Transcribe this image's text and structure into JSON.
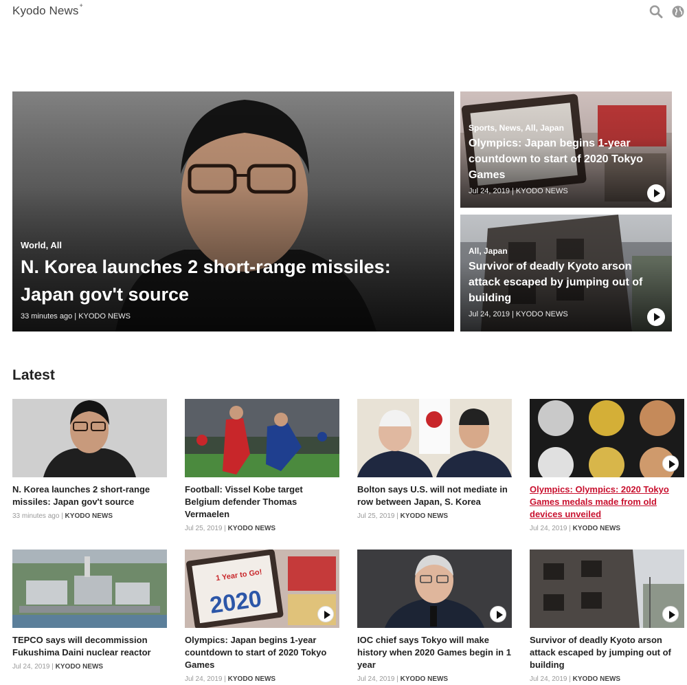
{
  "header": {
    "logo": "Kyodo News",
    "logo_mark": "+",
    "search_icon": "search-icon",
    "language_icon": "globe-icon"
  },
  "featured": {
    "main": {
      "categories": "World, All",
      "title": "N. Korea launches 2 short-range missiles: Japan gov't source",
      "time": "33 minutes ago",
      "source": "KYODO NEWS"
    },
    "side_top": {
      "categories": "Sports, News, All, Japan",
      "title": "Olympics: Japan begins 1-year countdown to start of 2020 Tokyo Games",
      "time": "Jul 24, 2019",
      "source": "KYODO NEWS"
    },
    "side_bottom": {
      "categories": "All, Japan",
      "title": "Survivor of deadly Kyoto arson attack escaped by jumping out of building",
      "time": "Jul 24, 2019",
      "source": "KYODO NEWS"
    }
  },
  "latest": {
    "heading": "Latest",
    "items": [
      {
        "title": "N. Korea launches 2 short-range missiles: Japan gov't source",
        "time": "33 minutes ago",
        "source": "KYODO NEWS"
      },
      {
        "title": "Football: Vissel Kobe target Belgium defender Thomas Vermaelen",
        "time": "Jul 25, 2019",
        "source": "KYODO NEWS"
      },
      {
        "title": "Bolton says U.S. will not mediate in row between Japan, S. Korea",
        "time": "Jul 25, 2019",
        "source": "KYODO NEWS"
      },
      {
        "title": "Olympics: Olympics: 2020 Tokyo Games medals made from old devices unveiled",
        "time": "Jul 24, 2019",
        "source": "KYODO NEWS"
      },
      {
        "title": "TEPCO says will decommission Fukushima Daini nuclear reactor",
        "time": "Jul 24, 2019",
        "source": "KYODO NEWS"
      },
      {
        "title": "Olympics: Japan begins 1-year countdown to start of 2020 Tokyo Games",
        "time": "Jul 24, 2019",
        "source": "KYODO NEWS"
      },
      {
        "title": "IOC chief says Tokyo will make history when 2020 Games begin in 1 year",
        "time": "Jul 24, 2019",
        "source": "KYODO NEWS"
      },
      {
        "title": "Survivor of deadly Kyoto arson attack escaped by jumping out of building",
        "time": "Jul 24, 2019",
        "source": "KYODO NEWS"
      }
    ]
  },
  "thumb_text": {
    "countdown_sign": "1 Year to Go!",
    "countdown_year": "2020"
  },
  "colors": {
    "hovered_link": "#c8102e",
    "meta_gray": "#999999"
  }
}
